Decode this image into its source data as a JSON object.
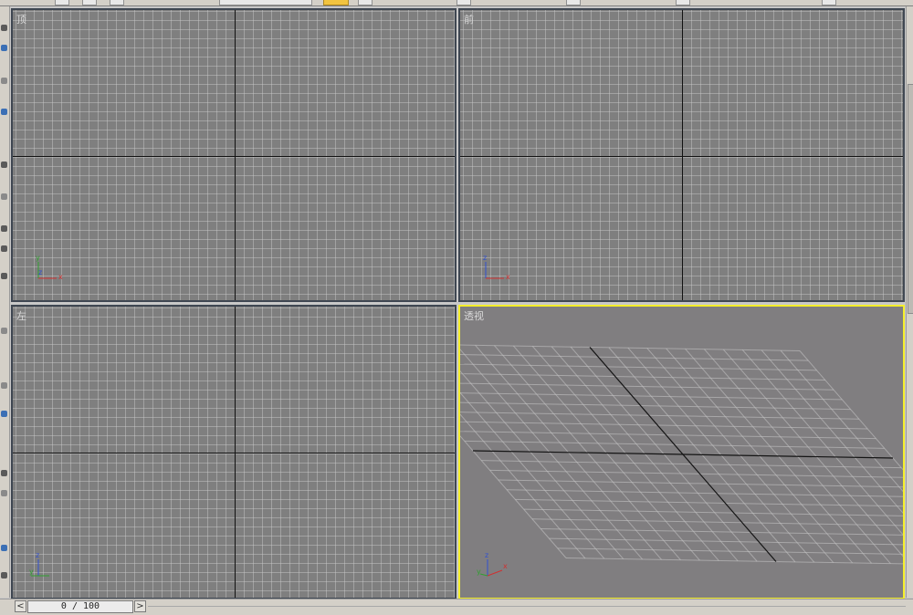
{
  "viewports": {
    "top": {
      "label": "顶",
      "axes": [
        "y",
        "z",
        "x"
      ]
    },
    "front": {
      "label": "前",
      "axes": [
        "z",
        "x"
      ]
    },
    "left": {
      "label": "左",
      "axes": [
        "z",
        "y"
      ]
    },
    "perspective": {
      "label": "透视",
      "axes": [
        "z",
        "y",
        "x"
      ],
      "active": true
    }
  },
  "timeline": {
    "current_frame": 0,
    "total_frames": 100,
    "display": "0 / 100",
    "prev_label": "<",
    "next_label": ">"
  },
  "colors": {
    "viewport_bg": "#7f7f7f",
    "grid_line": "#cdcdcd",
    "active_border": "#f4ee2a",
    "axis_x": "#d03030",
    "axis_y": "#30a030",
    "axis_z": "#3050d0"
  }
}
